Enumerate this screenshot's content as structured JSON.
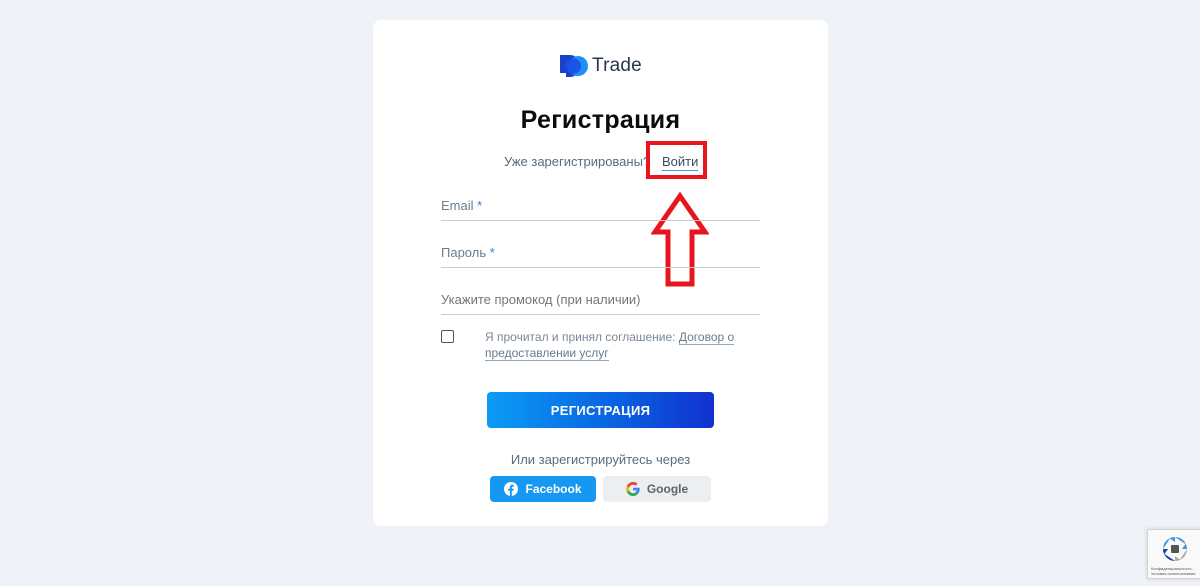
{
  "logo": {
    "text": "Trade",
    "colors": {
      "primary": "#1a4fe0",
      "secondary": "#1f8ff7"
    }
  },
  "title": "Регистрация",
  "login_prompt": {
    "text": "Уже зарегистрированы?",
    "link": "Войти"
  },
  "form": {
    "email": {
      "label": "Email",
      "required_mark": "*",
      "value": ""
    },
    "password": {
      "label": "Пароль",
      "required_mark": "*",
      "value": ""
    },
    "promo": {
      "placeholder": "Укажите промокод (при наличии)",
      "value": ""
    },
    "agreement": {
      "checked": false,
      "text": "Я прочитал и принял соглашение:",
      "link_part1": "Договор о",
      "link_part2": "предоставлении услуг"
    },
    "submit_label": "РЕГИСТРАЦИЯ"
  },
  "social": {
    "prompt": "Или зарегистрируйтесь через",
    "facebook_label": "Facebook",
    "google_label": "Google"
  },
  "recaptcha": {
    "text": "Конфиденциальность - Условия использования"
  },
  "annotation": {
    "color": "#e8141e"
  }
}
